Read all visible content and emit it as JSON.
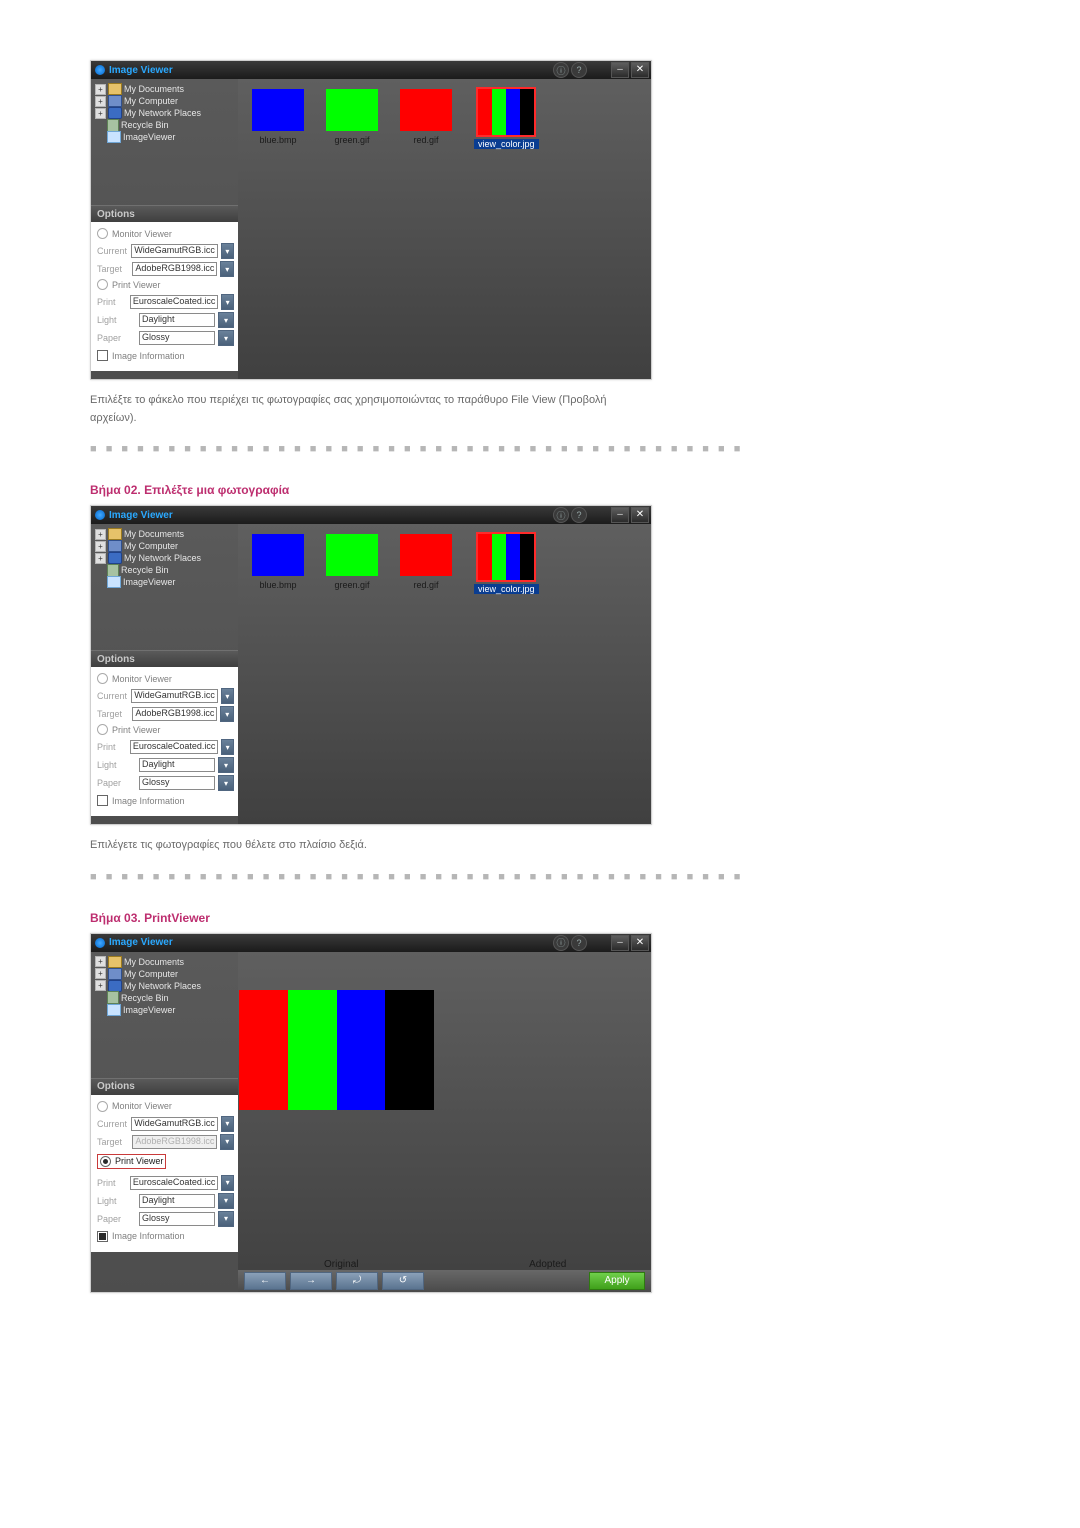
{
  "app_title": "Image Viewer",
  "titlebar_icons": {
    "a": "ⓘ",
    "b": "?"
  },
  "win_controls": {
    "min": "–",
    "close": "✕"
  },
  "tree": {
    "my_documents": "My Documents",
    "my_computer": "My Computer",
    "my_network_places": "My Network Places",
    "recycle_bin": "Recycle Bin",
    "image_viewer": "ImageViewer"
  },
  "options": {
    "header": "Options",
    "monitor_viewer": "Monitor Viewer",
    "current_label": "Current",
    "current_value": "WideGamutRGB.icc",
    "target_label": "Target",
    "target_value": "AdobeRGB1998.icc",
    "print_viewer": "Print Viewer",
    "print_label": "Print",
    "print_value": "EuroscaleCoated.icc",
    "light_label": "Light",
    "light_value": "Daylight",
    "paper_label": "Paper",
    "paper_value": "Glossy",
    "image_information": "Image Information"
  },
  "thumbs": {
    "blue": "blue.bmp",
    "green": "green.gif",
    "red": "red.gif",
    "view_color": "view_color.jpg"
  },
  "text": {
    "desc1": "Επιλέξτε το φάκελο που περιέχει τις φωτογραφίες σας χρησιμοποιώντας το παράθυρο File View (Προβολή αρχείων).",
    "step2": "Βήμα 02. Επιλέξτε μια φωτογραφία",
    "desc2": "Επιλέγετε τις φωτογραφίες που θέλετε στο πλαίσιο δεξιά.",
    "step3": "Βήμα 03. PrintViewer"
  },
  "separator": "■  ■  ■  ■  ■  ■  ■  ■  ■  ■  ■  ■  ■  ■  ■  ■  ■  ■  ■  ■  ■  ■  ■  ■  ■  ■  ■  ■  ■  ■  ■  ■  ■  ■  ■  ■  ■  ■  ■  ■  ■  ■",
  "printview": {
    "original": "Original",
    "adopted": "Adopted",
    "apply": "Apply"
  }
}
